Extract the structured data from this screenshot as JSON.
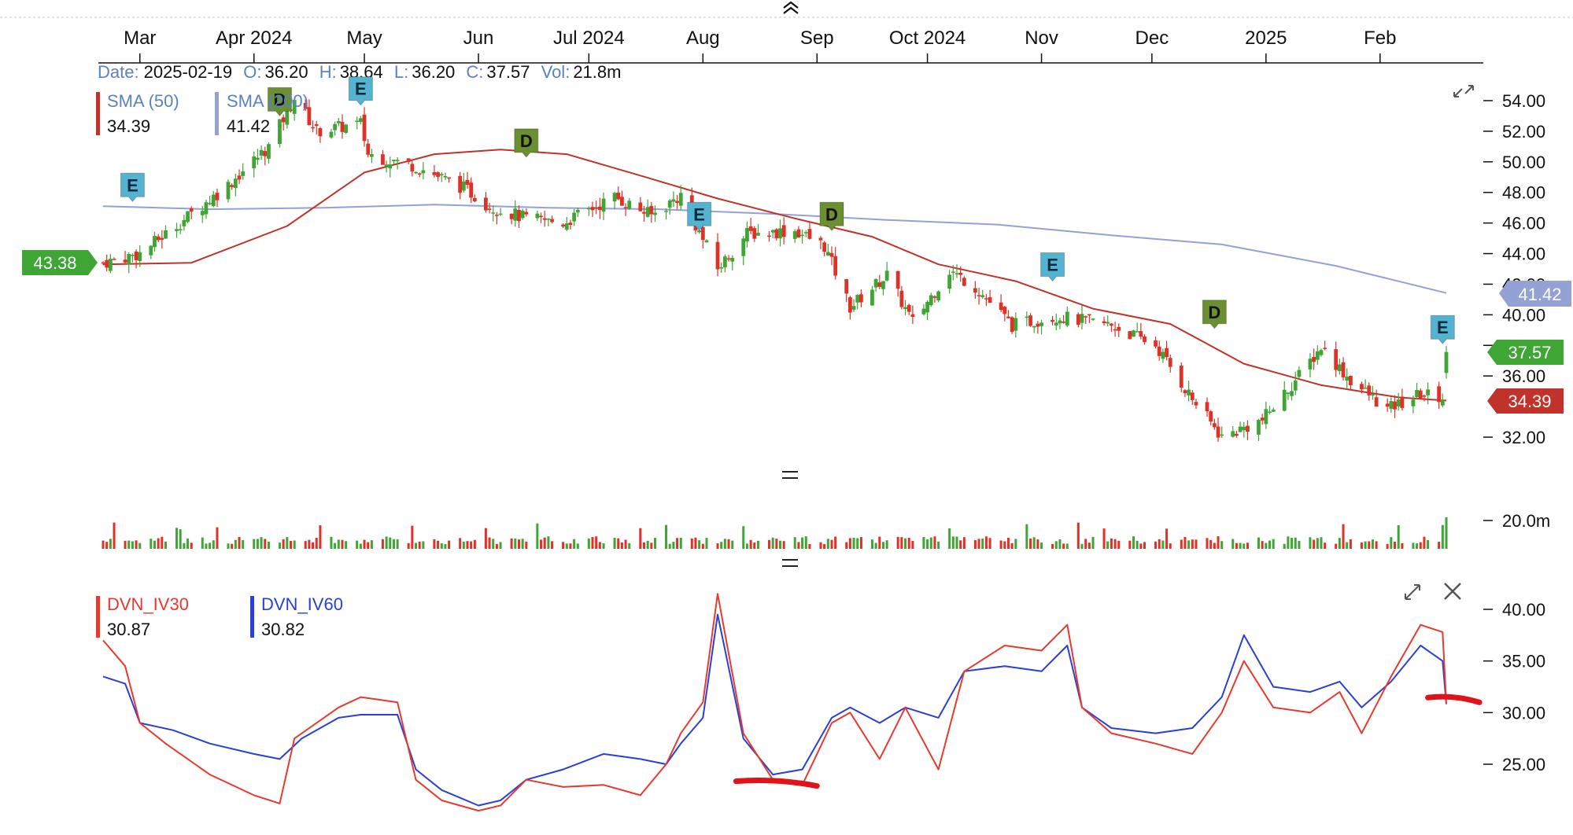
{
  "toolbar": {
    "collapse_icon": "double-chevron-up-icon"
  },
  "header": {
    "date_label": "Date:",
    "date": "2025-02-19",
    "o_label": "O:",
    "open": "36.20",
    "h_label": "H:",
    "high": "38.64",
    "l_label": "L:",
    "low": "36.20",
    "c_label": "C:",
    "close": "37.57",
    "vol_label": "Vol:",
    "volume": "21.8m"
  },
  "price_legend": {
    "sma50_label": "SMA (50)",
    "sma50_value": "34.39",
    "sma200_label": "SMA (200)",
    "sma200_value": "41.42"
  },
  "iv_legend": {
    "iv30_label": "DVN_IV30",
    "iv30_value": "30.87",
    "iv60_label": "DVN_IV60",
    "iv60_value": "30.82"
  },
  "badges": {
    "left_price": "43.38",
    "last_close": "37.57",
    "sma200": "41.42",
    "sma50": "34.39"
  },
  "colors": {
    "up": "#3fa535",
    "down": "#e03127",
    "sma50": "#c0322a",
    "sma200": "#93a1d4",
    "iv30": "#e8392e",
    "iv60": "#2b3fd6",
    "marker_e": "#55b3d2",
    "marker_d": "#6b8f31",
    "annotation": "#e0121a",
    "axis_text": "#111111"
  },
  "icons": {
    "expand_price": "expand-arrows-icon",
    "expand_iv": "expand-arrows-icon",
    "close_iv": "close-icon",
    "divider": "drag-handle-icon"
  },
  "chart_data": [
    {
      "type": "candlestick",
      "x_tick_labels": [
        "Mar",
        "Apr 2024",
        "May",
        "Jun",
        "Jul 2024",
        "Aug",
        "Sep",
        "Oct 2024",
        "Nov",
        "Dec",
        "2025",
        "Feb"
      ],
      "x_range": [
        "2024-02-20",
        "2025-02-19"
      ],
      "y_tick_labels": [
        "54.00",
        "52.00",
        "50.00",
        "48.00",
        "46.00",
        "44.00",
        "42.00",
        "40.00",
        "38.00",
        "36.00",
        "32.00"
      ],
      "ylim": [
        30.5,
        55.5
      ],
      "close_path": [
        [
          "2024-02-20",
          43.4
        ],
        [
          "2024-03-01",
          44.0
        ],
        [
          "2024-03-15",
          46.6
        ],
        [
          "2024-03-25",
          48.5
        ],
        [
          "2024-04-05",
          51.0
        ],
        [
          "2024-04-12",
          54.2
        ],
        [
          "2024-04-18",
          52.0
        ],
        [
          "2024-04-30",
          52.5
        ],
        [
          "2024-05-02",
          50.5
        ],
        [
          "2024-05-15",
          49.7
        ],
        [
          "2024-05-28",
          48.3
        ],
        [
          "2024-06-04",
          47.1
        ],
        [
          "2024-06-14",
          46.3
        ],
        [
          "2024-06-24",
          46.0
        ],
        [
          "2024-07-08",
          47.7
        ],
        [
          "2024-07-18",
          46.5
        ],
        [
          "2024-07-26",
          47.8
        ],
        [
          "2024-08-05",
          43.0
        ],
        [
          "2024-08-13",
          45.3
        ],
        [
          "2024-08-26",
          45.5
        ],
        [
          "2024-09-03",
          44.5
        ],
        [
          "2024-09-10",
          40.5
        ],
        [
          "2024-09-20",
          42.6
        ],
        [
          "2024-09-27",
          39.5
        ],
        [
          "2024-10-07",
          42.9
        ],
        [
          "2024-10-14",
          41.8
        ],
        [
          "2024-10-24",
          39.3
        ],
        [
          "2024-11-05",
          39.9
        ],
        [
          "2024-11-20",
          39.3
        ],
        [
          "2024-12-02",
          38.0
        ],
        [
          "2024-12-12",
          34.5
        ],
        [
          "2024-12-20",
          32.0
        ],
        [
          "2024-12-31",
          33.1
        ],
        [
          "2025-01-10",
          36.0
        ],
        [
          "2025-01-16",
          37.9
        ],
        [
          "2025-01-24",
          35.7
        ],
        [
          "2025-02-03",
          33.8
        ],
        [
          "2025-02-12",
          34.8
        ],
        [
          "2025-02-18",
          34.6
        ],
        [
          "2025-02-19",
          37.57
        ]
      ],
      "sma50": [
        [
          "2024-02-20",
          43.3
        ],
        [
          "2024-03-15",
          43.4
        ],
        [
          "2024-04-10",
          45.8
        ],
        [
          "2024-05-01",
          49.3
        ],
        [
          "2024-05-20",
          50.5
        ],
        [
          "2024-06-07",
          50.8
        ],
        [
          "2024-06-25",
          50.5
        ],
        [
          "2024-07-15",
          49.1
        ],
        [
          "2024-08-05",
          47.6
        ],
        [
          "2024-08-26",
          46.3
        ],
        [
          "2024-09-16",
          45.1
        ],
        [
          "2024-10-04",
          43.3
        ],
        [
          "2024-10-25",
          42.2
        ],
        [
          "2024-11-15",
          40.4
        ],
        [
          "2024-12-06",
          39.4
        ],
        [
          "2024-12-26",
          36.8
        ],
        [
          "2025-01-16",
          35.4
        ],
        [
          "2025-02-06",
          34.6
        ],
        [
          "2025-02-19",
          34.39
        ]
      ],
      "sma200": [
        [
          "2024-02-20",
          47.1
        ],
        [
          "2024-03-20",
          46.9
        ],
        [
          "2024-04-20",
          47.0
        ],
        [
          "2024-05-20",
          47.2
        ],
        [
          "2024-06-20",
          47.0
        ],
        [
          "2024-07-20",
          46.9
        ],
        [
          "2024-08-20",
          46.6
        ],
        [
          "2024-09-20",
          46.2
        ],
        [
          "2024-10-20",
          45.9
        ],
        [
          "2024-11-20",
          45.2
        ],
        [
          "2024-12-20",
          44.6
        ],
        [
          "2025-01-20",
          43.2
        ],
        [
          "2025-02-19",
          41.42
        ]
      ],
      "event_markers": [
        {
          "date": "2024-02-28",
          "label": "E",
          "price": 47.2
        },
        {
          "date": "2024-04-08",
          "label": "D",
          "price": 52.8
        },
        {
          "date": "2024-04-30",
          "label": "E",
          "price": 53.5
        },
        {
          "date": "2024-06-14",
          "label": "D",
          "price": 50.1
        },
        {
          "date": "2024-07-31",
          "label": "E",
          "price": 45.3
        },
        {
          "date": "2024-09-05",
          "label": "D",
          "price": 45.3
        },
        {
          "date": "2024-11-04",
          "label": "E",
          "price": 42.0
        },
        {
          "date": "2024-12-18",
          "label": "D",
          "price": 38.9
        },
        {
          "date": "2025-02-18",
          "label": "E",
          "price": 37.9
        }
      ],
      "volume": {
        "axis_label": "20.0m",
        "last": "21.8m"
      }
    },
    {
      "type": "line",
      "y_tick_labels": [
        "40.00",
        "35.00",
        "30.00",
        "25.00"
      ],
      "ylim": [
        19,
        43
      ],
      "series": [
        {
          "name": "DVN_IV30",
          "points": [
            [
              "2024-02-20",
              37.0
            ],
            [
              "2024-02-26",
              34.5
            ],
            [
              "2024-03-01",
              29.0
            ],
            [
              "2024-03-08",
              27.0
            ],
            [
              "2024-03-20",
              24.0
            ],
            [
              "2024-04-01",
              22.0
            ],
            [
              "2024-04-08",
              21.2
            ],
            [
              "2024-04-12",
              27.5
            ],
            [
              "2024-04-24",
              30.5
            ],
            [
              "2024-04-30",
              31.5
            ],
            [
              "2024-05-10",
              31.0
            ],
            [
              "2024-05-15",
              23.5
            ],
            [
              "2024-05-22",
              21.5
            ],
            [
              "2024-06-01",
              20.5
            ],
            [
              "2024-06-07",
              21.0
            ],
            [
              "2024-06-14",
              23.5
            ],
            [
              "2024-06-24",
              22.8
            ],
            [
              "2024-07-05",
              23.0
            ],
            [
              "2024-07-15",
              22.0
            ],
            [
              "2024-07-22",
              25.0
            ],
            [
              "2024-07-26",
              28.0
            ],
            [
              "2024-08-01",
              31.0
            ],
            [
              "2024-08-05",
              41.5
            ],
            [
              "2024-08-12",
              28.0
            ],
            [
              "2024-08-20",
              23.5
            ],
            [
              "2024-08-28",
              23.0
            ],
            [
              "2024-09-05",
              29.0
            ],
            [
              "2024-09-10",
              30.0
            ],
            [
              "2024-09-18",
              25.5
            ],
            [
              "2024-09-25",
              30.5
            ],
            [
              "2024-10-04",
              24.5
            ],
            [
              "2024-10-11",
              34.0
            ],
            [
              "2024-10-22",
              36.5
            ],
            [
              "2024-11-01",
              36.0
            ],
            [
              "2024-11-08",
              38.5
            ],
            [
              "2024-11-12",
              30.5
            ],
            [
              "2024-11-20",
              28.0
            ],
            [
              "2024-12-02",
              27.0
            ],
            [
              "2024-12-12",
              26.0
            ],
            [
              "2024-12-20",
              30.0
            ],
            [
              "2024-12-26",
              35.0
            ],
            [
              "2025-01-03",
              30.5
            ],
            [
              "2025-01-13",
              30.0
            ],
            [
              "2025-01-21",
              32.0
            ],
            [
              "2025-01-27",
              28.0
            ],
            [
              "2025-02-04",
              33.5
            ],
            [
              "2025-02-12",
              38.5
            ],
            [
              "2025-02-18",
              37.8
            ],
            [
              "2025-02-19",
              30.87
            ]
          ]
        },
        {
          "name": "DVN_IV60",
          "points": [
            [
              "2024-02-20",
              33.5
            ],
            [
              "2024-02-26",
              32.8
            ],
            [
              "2024-03-01",
              29.0
            ],
            [
              "2024-03-10",
              28.3
            ],
            [
              "2024-03-20",
              27.0
            ],
            [
              "2024-04-01",
              26.0
            ],
            [
              "2024-04-08",
              25.5
            ],
            [
              "2024-04-14",
              27.5
            ],
            [
              "2024-04-24",
              29.5
            ],
            [
              "2024-04-30",
              29.8
            ],
            [
              "2024-05-10",
              29.8
            ],
            [
              "2024-05-15",
              24.5
            ],
            [
              "2024-05-22",
              22.5
            ],
            [
              "2024-06-01",
              21.0
            ],
            [
              "2024-06-07",
              21.5
            ],
            [
              "2024-06-14",
              23.5
            ],
            [
              "2024-06-24",
              24.5
            ],
            [
              "2024-07-05",
              26.0
            ],
            [
              "2024-07-15",
              25.5
            ],
            [
              "2024-07-22",
              25.0
            ],
            [
              "2024-07-26",
              27.0
            ],
            [
              "2024-08-01",
              29.5
            ],
            [
              "2024-08-05",
              39.5
            ],
            [
              "2024-08-12",
              27.5
            ],
            [
              "2024-08-20",
              24.0
            ],
            [
              "2024-08-28",
              24.5
            ],
            [
              "2024-09-05",
              29.5
            ],
            [
              "2024-09-10",
              30.5
            ],
            [
              "2024-09-18",
              29.0
            ],
            [
              "2024-09-25",
              30.5
            ],
            [
              "2024-10-04",
              29.5
            ],
            [
              "2024-10-11",
              34.0
            ],
            [
              "2024-10-22",
              34.5
            ],
            [
              "2024-11-01",
              34.0
            ],
            [
              "2024-11-08",
              36.5
            ],
            [
              "2024-11-12",
              30.5
            ],
            [
              "2024-11-20",
              28.5
            ],
            [
              "2024-12-02",
              28.0
            ],
            [
              "2024-12-12",
              28.5
            ],
            [
              "2024-12-20",
              31.5
            ],
            [
              "2024-12-26",
              37.5
            ],
            [
              "2025-01-03",
              32.5
            ],
            [
              "2025-01-13",
              32.0
            ],
            [
              "2025-01-21",
              33.0
            ],
            [
              "2025-01-27",
              30.5
            ],
            [
              "2025-02-04",
              33.0
            ],
            [
              "2025-02-12",
              36.5
            ],
            [
              "2025-02-18",
              35.0
            ],
            [
              "2025-02-19",
              30.82
            ]
          ]
        }
      ],
      "annotations": [
        {
          "type": "hand-drawn-underline",
          "from": "2024-08-10",
          "to": "2024-09-01",
          "level": 23.2
        },
        {
          "type": "hand-drawn-underline",
          "from": "2025-02-14",
          "to": "2025-02-28",
          "level": 31.3
        }
      ]
    }
  ]
}
